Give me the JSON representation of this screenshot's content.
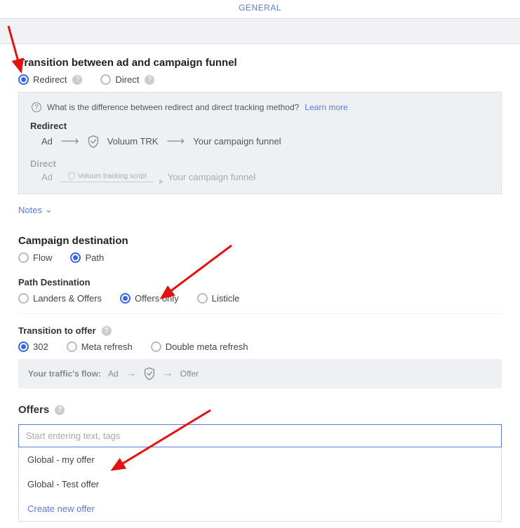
{
  "header": {
    "tab": "GENERAL"
  },
  "transition": {
    "title": "Transition between ad and campaign funnel",
    "options": {
      "redirect": "Redirect",
      "direct": "Direct"
    },
    "info": {
      "question": "What is the difference between redirect and direct tracking method?",
      "learn_more": "Learn more",
      "redirect": {
        "label": "Redirect",
        "ad": "Ad",
        "trk": "Voluum TRK",
        "funnel": "Your campaign funnel"
      },
      "direct": {
        "label": "Direct",
        "ad": "Ad",
        "script": "Voluum tracking script",
        "funnel": "Your campaign funnel"
      }
    },
    "notes": "Notes"
  },
  "destination": {
    "title": "Campaign destination",
    "options": {
      "flow": "Flow",
      "path": "Path"
    },
    "path_label": "Path Destination",
    "path_options": {
      "landers_offers": "Landers & Offers",
      "offers_only": "Offers only",
      "listicle": "Listicle"
    }
  },
  "transition_offer": {
    "title": "Transition to offer",
    "options": {
      "t302": "302",
      "meta": "Meta refresh",
      "double_meta": "Double meta refresh"
    },
    "flow_label": "Your traffic's flow:",
    "ad": "Ad",
    "offer": "Offer"
  },
  "offers": {
    "title": "Offers",
    "placeholder": "Start entering text, tags",
    "dropdown": {
      "item1": "Global - my offer",
      "item2": "Global - Test offer",
      "create": "Create new offer"
    }
  }
}
